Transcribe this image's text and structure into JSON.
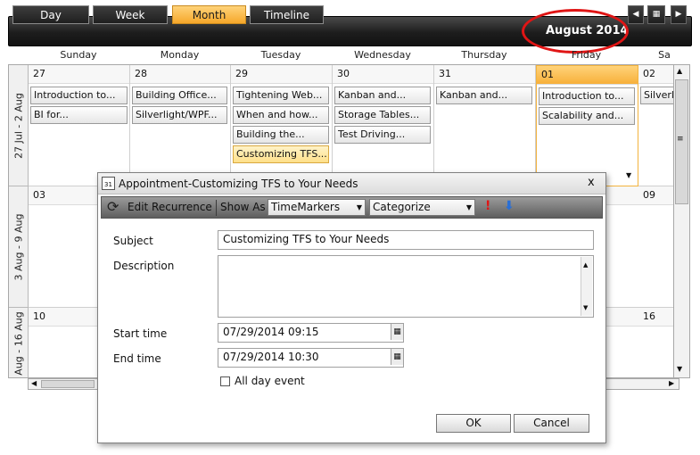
{
  "toolbar": {
    "views": [
      "Day",
      "Week",
      "Month",
      "Timeline"
    ],
    "active_view": "Month",
    "month_title": "August 2014"
  },
  "day_headers": [
    "Sunday",
    "Monday",
    "Tuesday",
    "Wednesday",
    "Thursday",
    "Friday",
    "Sa"
  ],
  "weeks": [
    {
      "label": "27 Jul - 2 Aug",
      "days": [
        "27",
        "28",
        "29",
        "30",
        "31",
        "01",
        "02"
      ]
    },
    {
      "label": "3 Aug - 9 Aug",
      "days": [
        "03",
        "",
        "",
        "",
        "",
        "",
        "09"
      ]
    },
    {
      "label": "Aug - 16 Aug",
      "days": [
        "10",
        "",
        "",
        "",
        "",
        "",
        "16"
      ]
    }
  ],
  "appointments": {
    "sun": [
      "Introduction to...",
      "BI for..."
    ],
    "mon": [
      "Building Office...",
      "Silverlight/WPF..."
    ],
    "tue": [
      "Tightening Web...",
      "When and how...",
      "Building the...",
      "Customizing TFS..."
    ],
    "wed": [
      "Kanban and...",
      "Storage Tables...",
      "Test Driving..."
    ],
    "thu": [
      "Kanban and..."
    ],
    "fri": [
      "Introduction to...",
      "Scalability and..."
    ],
    "sat": [
      "Silverlig"
    ]
  },
  "dialog": {
    "title": "Appointment-Customizing TFS to Your Needs",
    "close": "x",
    "edit_recurrence": "Edit Recurrence",
    "show_as_label": "Show As",
    "show_as_value": "TimeMarkers",
    "categorize_value": "Categorize",
    "subject_label": "Subject",
    "subject_value": "Customizing TFS to Your Needs",
    "description_label": "Description",
    "description_value": "",
    "start_label": "Start time",
    "start_value": "07/29/2014 09:15",
    "end_label": "End time",
    "end_value": "07/29/2014 10:30",
    "all_day_label": "All day event",
    "ok": "OK",
    "cancel": "Cancel"
  }
}
